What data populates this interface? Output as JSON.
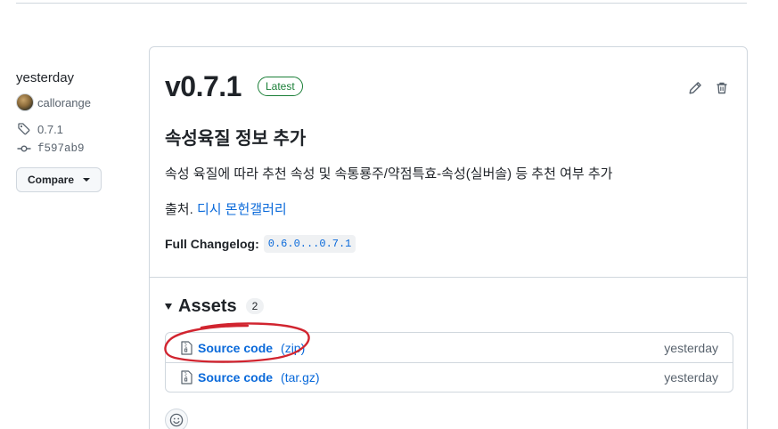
{
  "meta": {
    "date": "yesterday",
    "author": "callorange",
    "tag": "0.7.1",
    "commit": "f597ab9",
    "compare_label": "Compare"
  },
  "release": {
    "version": "v0.7.1",
    "badge": "Latest",
    "heading": "속성육질 정보 추가",
    "description": "속성 육질에 따라 추천 속성 및 속통룡주/약점특효-속성(실버솔) 등 추천 여부 추가",
    "source_prefix": "출처.",
    "source_link": "디시 몬헌갤러리",
    "changelog_label": "Full Changelog:",
    "changelog_range": "0.6.0...0.7.1"
  },
  "assets": {
    "title": "Assets",
    "count": "2",
    "items": [
      {
        "name": "Source code",
        "ext": "(zip)",
        "time": "yesterday"
      },
      {
        "name": "Source code",
        "ext": "(tar.gz)",
        "time": "yesterday"
      }
    ]
  },
  "colors": {
    "link": "#0969da",
    "latest": "#1a7f37",
    "annotation": "#d1242f"
  },
  "icons": {
    "tag": "tag-icon",
    "commit": "git-commit-icon",
    "edit": "pencil-icon",
    "delete": "trash-icon",
    "zip": "file-zip-icon",
    "reaction": "smiley-icon"
  }
}
